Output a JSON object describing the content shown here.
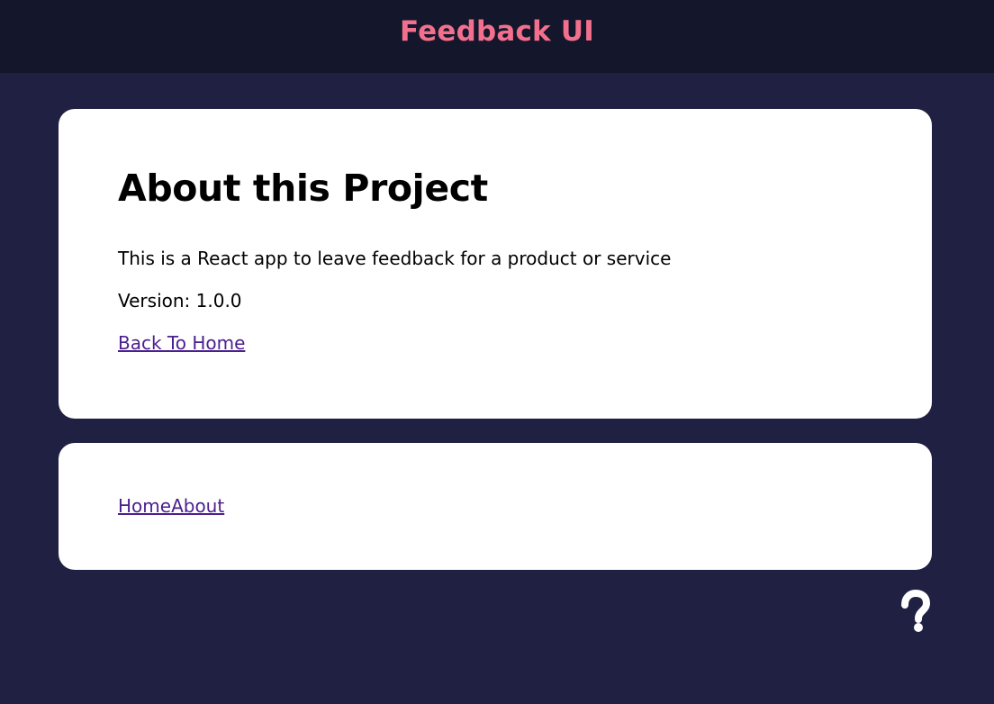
{
  "header": {
    "title": "Feedback UI"
  },
  "about": {
    "title": "About this Project",
    "description": "This is a React app to leave feedback for a product or service",
    "version": "Version: 1.0.0",
    "back_link": "Back To Home"
  },
  "nav": {
    "links": [
      "Home",
      "About"
    ]
  },
  "help": {
    "icon": "question-mark-icon"
  },
  "colors": {
    "background": "#202142",
    "header_background": "#14162b",
    "accent": "#f2708d",
    "card": "#ffffff",
    "link": "#4b1f8f",
    "help_icon": "#ffffff"
  }
}
